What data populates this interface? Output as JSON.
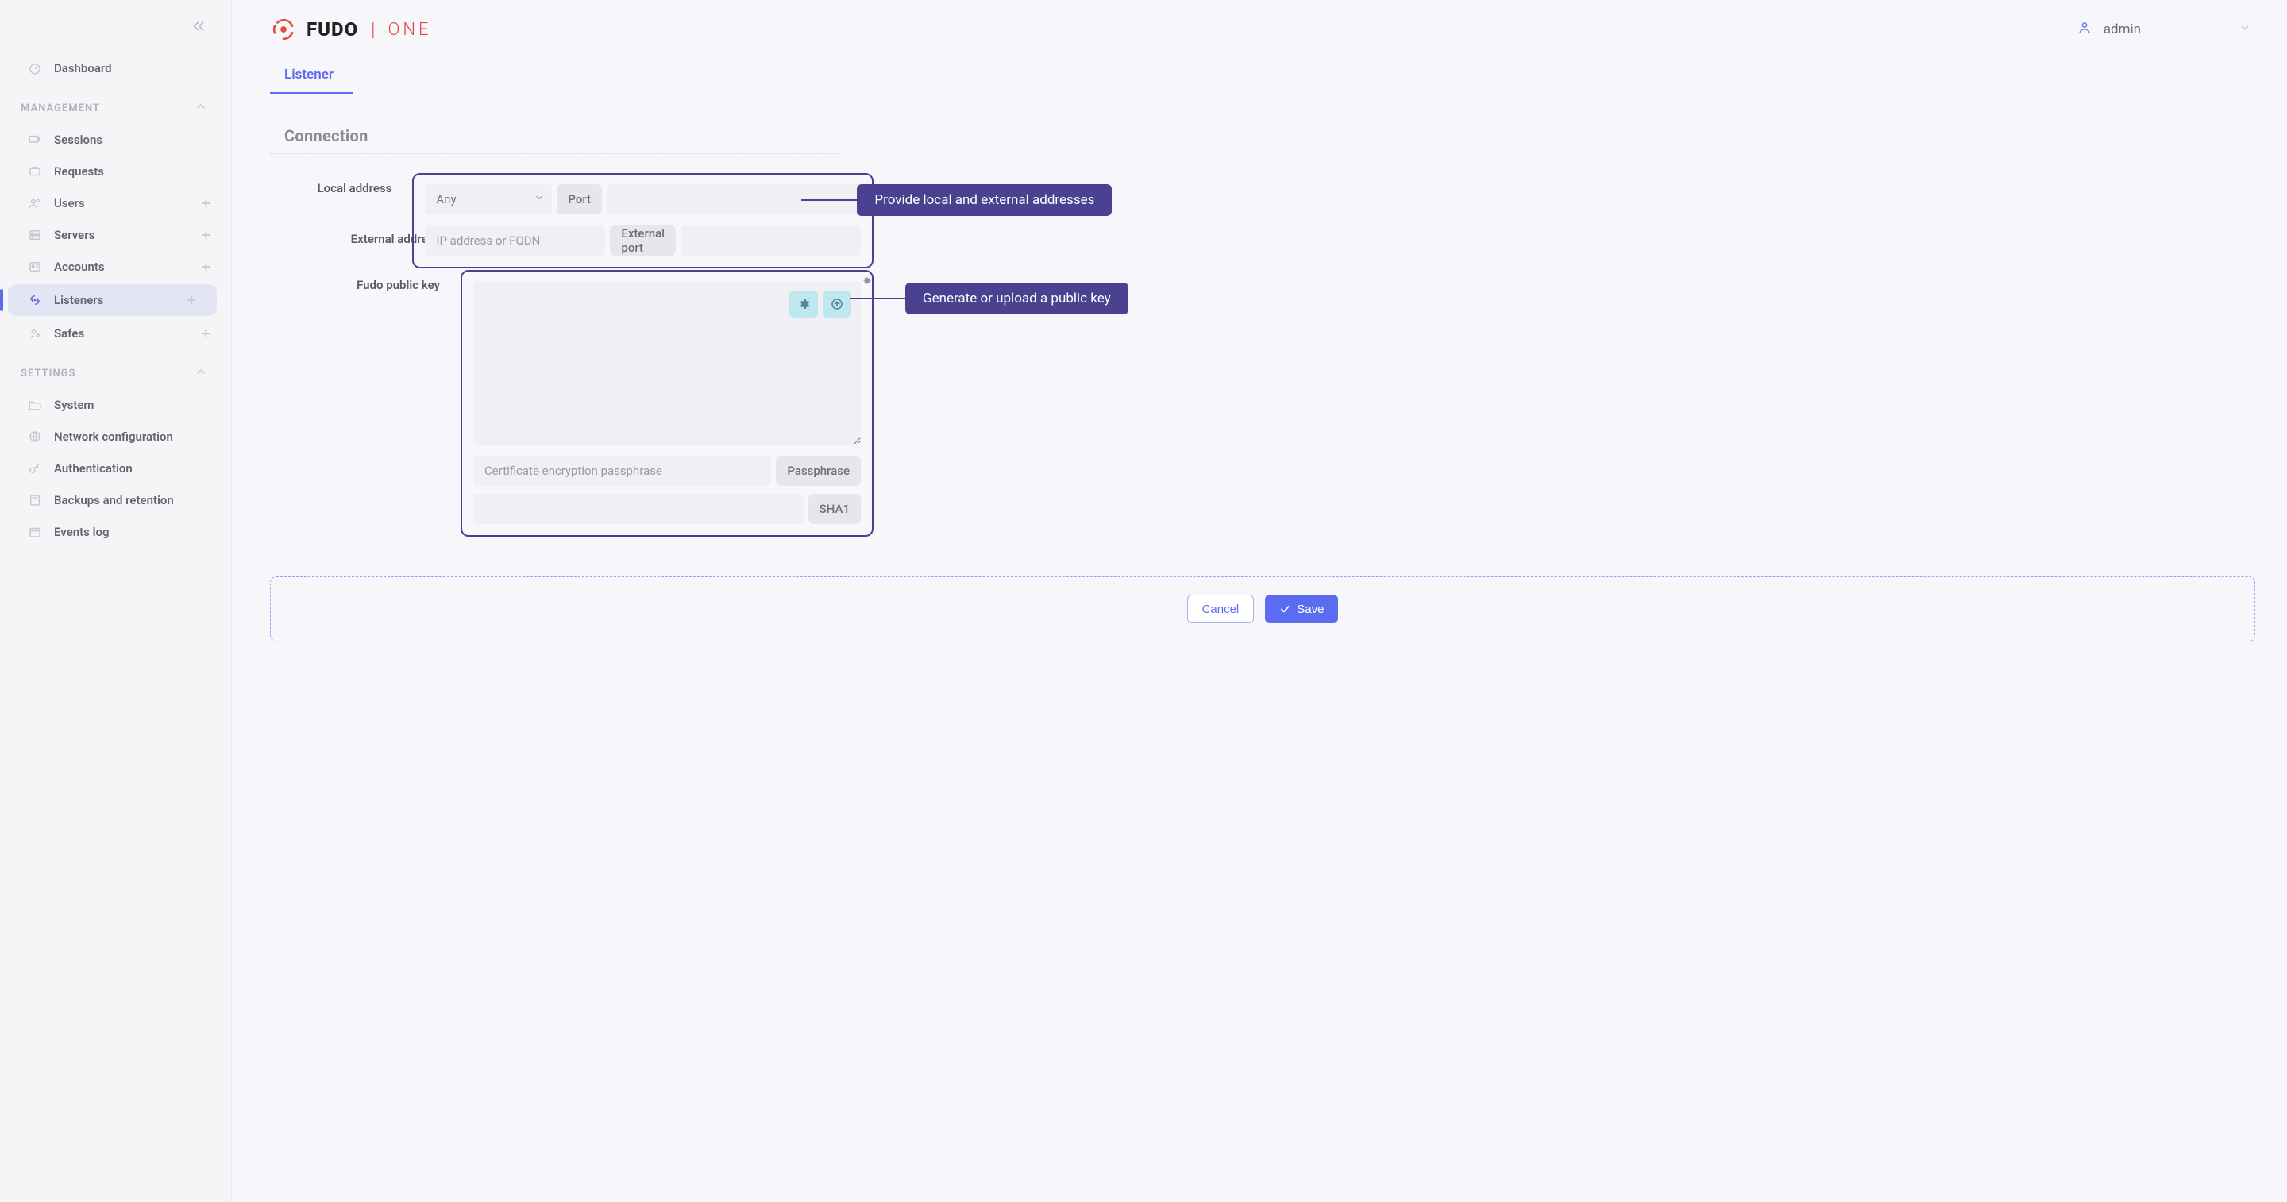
{
  "brand": {
    "word": "FUDO",
    "sub": "ONE"
  },
  "user": {
    "name": "admin"
  },
  "sidebar": {
    "dashboard": "Dashboard",
    "section_management": "MANAGEMENT",
    "section_settings": "SETTINGS",
    "management": [
      {
        "label": "Sessions",
        "icon": "sessions",
        "add": false
      },
      {
        "label": "Requests",
        "icon": "requests",
        "add": false
      },
      {
        "label": "Users",
        "icon": "users",
        "add": true
      },
      {
        "label": "Servers",
        "icon": "servers",
        "add": true
      },
      {
        "label": "Accounts",
        "icon": "accounts",
        "add": true
      },
      {
        "label": "Listeners",
        "icon": "listeners",
        "add": true
      },
      {
        "label": "Safes",
        "icon": "safes",
        "add": true
      }
    ],
    "settings": [
      {
        "label": "System"
      },
      {
        "label": "Network configuration"
      },
      {
        "label": "Authentication"
      },
      {
        "label": "Backups and retention"
      },
      {
        "label": "Events log"
      }
    ],
    "active": "Listeners"
  },
  "tabs": {
    "listener": "Listener"
  },
  "section": {
    "title": "Connection"
  },
  "form": {
    "local_label": "Local address",
    "local_select_value": "Any",
    "local_port_addon": "Port",
    "external_label": "External address",
    "external_ip_placeholder": "IP address or FQDN",
    "external_port_addon": "External port",
    "key_label": "Fudo public key",
    "passphrase_placeholder": "Certificate encryption passphrase",
    "passphrase_addon": "Passphrase",
    "sha_addon": "SHA1"
  },
  "callouts": {
    "addresses": "Provide local and external addresses",
    "publickey": "Generate or upload a public key"
  },
  "actions": {
    "cancel": "Cancel",
    "save": "Save"
  },
  "icons": {
    "gear": "gear-icon",
    "upload": "upload-icon",
    "star": "required-icon",
    "check": "check-icon",
    "user": "user-icon",
    "chev_l": "chevrons-left-icon",
    "chev_u": "chevron-up-icon",
    "chev_d": "chevron-down-icon"
  },
  "colors": {
    "accent": "#5b6cf0",
    "brand_red": "#e34b44",
    "group_border": "#4a4190",
    "callout_bg": "#4a4190",
    "icon_btn_bg": "#bfe8ee"
  }
}
